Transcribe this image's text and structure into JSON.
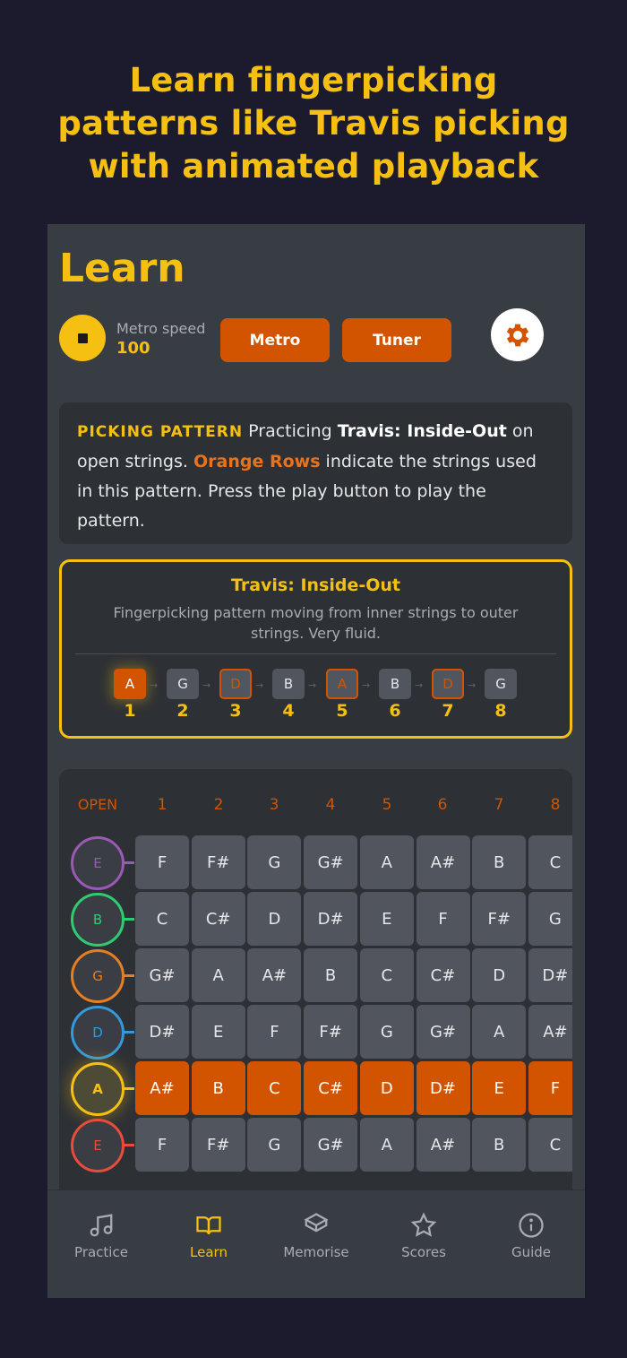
{
  "promo": {
    "line1": "Learn fingerpicking",
    "line2": "patterns like Travis picking",
    "line3": "with animated playback"
  },
  "header": {
    "title": "Learn"
  },
  "controls": {
    "metro_speed_label": "Metro speed",
    "metro_speed_value": "100",
    "metro_button": "Metro",
    "tuner_button": "Tuner",
    "stop_icon": "stop-icon",
    "settings_icon": "gear-icon"
  },
  "info": {
    "keyword": "PICKING PATTERN",
    "text1": " Practicing ",
    "pattern_name": "Travis: Inside-Out",
    "text2": " on open strings. ",
    "orange_rows": "Orange Rows",
    "text3": " indicate the strings used in this pattern. Press the play button to play the pattern."
  },
  "pattern": {
    "title": "Travis: Inside-Out",
    "description": "Fingerpicking pattern moving from inner strings to outer strings. Very fluid.",
    "steps": [
      {
        "note": "A",
        "num": "1",
        "state": "active"
      },
      {
        "note": "G",
        "num": "2",
        "state": "normal"
      },
      {
        "note": "D",
        "num": "3",
        "state": "outline"
      },
      {
        "note": "B",
        "num": "4",
        "state": "normal"
      },
      {
        "note": "A",
        "num": "5",
        "state": "outline"
      },
      {
        "note": "B",
        "num": "6",
        "state": "normal"
      },
      {
        "note": "D",
        "num": "7",
        "state": "outline"
      },
      {
        "note": "G",
        "num": "8",
        "state": "normal"
      }
    ]
  },
  "fretboard": {
    "headers": [
      "OPEN",
      "1",
      "2",
      "3",
      "4",
      "5",
      "6",
      "7",
      "8"
    ],
    "strings": [
      {
        "open": "E",
        "color": "#9b59b6",
        "highlight": false,
        "notes": [
          "F",
          "F#",
          "G",
          "G#",
          "A",
          "A#",
          "B",
          "C"
        ]
      },
      {
        "open": "B",
        "color": "#2ecc71",
        "highlight": false,
        "notes": [
          "C",
          "C#",
          "D",
          "D#",
          "E",
          "F",
          "F#",
          "G"
        ]
      },
      {
        "open": "G",
        "color": "#e67e22",
        "highlight": false,
        "notes": [
          "G#",
          "A",
          "A#",
          "B",
          "C",
          "C#",
          "D",
          "D#"
        ]
      },
      {
        "open": "D",
        "color": "#3498db",
        "highlight": false,
        "notes": [
          "D#",
          "E",
          "F",
          "F#",
          "G",
          "G#",
          "A",
          "A#"
        ]
      },
      {
        "open": "A",
        "color": "#f6c013",
        "highlight": true,
        "notes": [
          "A#",
          "B",
          "C",
          "C#",
          "D",
          "D#",
          "E",
          "F"
        ]
      },
      {
        "open": "E",
        "color": "#e74c3c",
        "highlight": false,
        "notes": [
          "F",
          "F#",
          "G",
          "G#",
          "A",
          "A#",
          "B",
          "C"
        ]
      }
    ]
  },
  "tabs": [
    {
      "label": "Practice",
      "icon": "music-note-icon",
      "active": false
    },
    {
      "label": "Learn",
      "icon": "book-icon",
      "active": true
    },
    {
      "label": "Memorise",
      "icon": "cube-icon",
      "active": false
    },
    {
      "label": "Scores",
      "icon": "star-icon",
      "active": false
    },
    {
      "label": "Guide",
      "icon": "info-icon",
      "active": false
    }
  ],
  "colors": {
    "accent": "#f6c013",
    "orange": "#d35400",
    "background": "#1b1b2d",
    "panel": "#383c43"
  }
}
